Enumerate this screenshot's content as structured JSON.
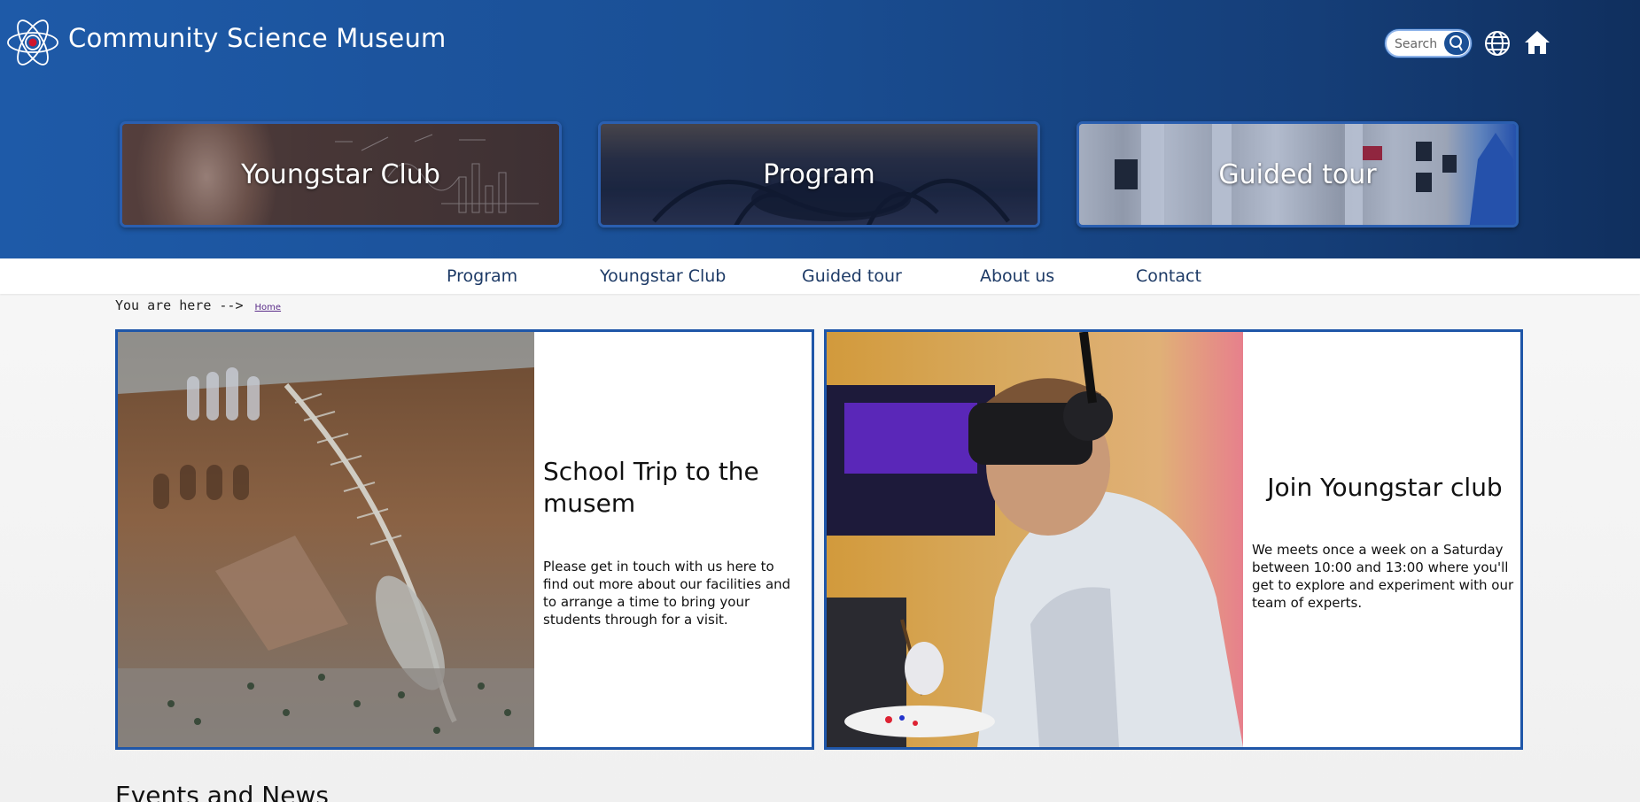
{
  "header": {
    "site_title": "Community Science Museum",
    "logo_icon": "atom-logo-icon",
    "search_placeholder": "Search",
    "search_icon": "search-icon",
    "language_icon": "globe-icon",
    "home_icon": "home-icon",
    "colors": {
      "gradient_start": "#1e5aa8",
      "gradient_end": "#102f5e",
      "accent": "#2b5fb0"
    }
  },
  "tiles": [
    {
      "label": "Youngstar Club"
    },
    {
      "label": "Program"
    },
    {
      "label": "Guided tour"
    }
  ],
  "nav": {
    "items": [
      {
        "label": "Program"
      },
      {
        "label": "Youngstar Club"
      },
      {
        "label": "Guided tour"
      },
      {
        "label": "About us"
      },
      {
        "label": "Contact"
      }
    ]
  },
  "breadcrumb": {
    "prefix": "You are here -->",
    "home_link": "Home"
  },
  "cards": [
    {
      "title": "School Trip to the musem",
      "text": "Please get in touch with us here to find out more about our facilities and to arrange a time to bring your students through for a visit."
    },
    {
      "title": "Join Youngstar club",
      "text": "We meets once a week on a Saturday between 10:00 and 13:00 where you'll get to explore and experiment with our team of experts."
    }
  ],
  "events": {
    "title": "Events and News"
  }
}
